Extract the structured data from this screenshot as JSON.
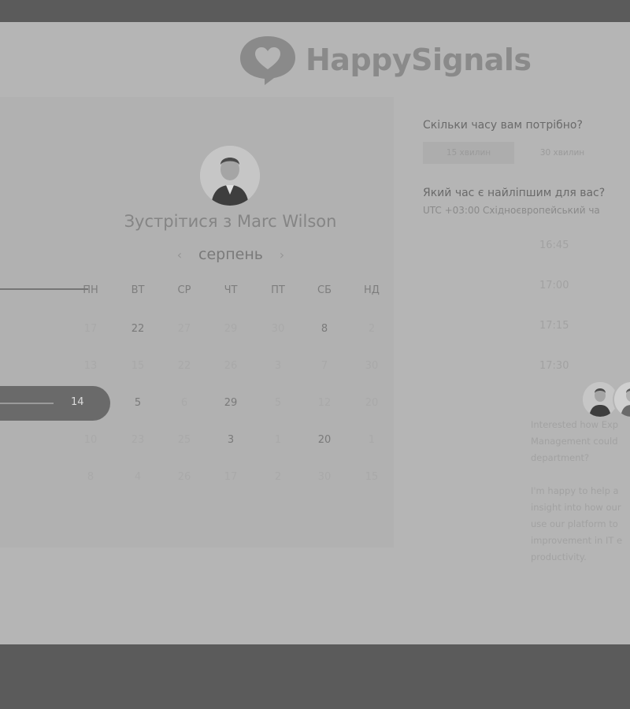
{
  "brand": {
    "name": "HappySignals"
  },
  "calendar": {
    "title": "Зустрітися з Marc Wilson",
    "month": "серпень",
    "prev_icon": "‹",
    "next_icon": "›",
    "weekdays": [
      "ПН",
      "ВТ",
      "СР",
      "ЧТ",
      "ПТ",
      "СБ",
      "НД"
    ],
    "selected_day": "14",
    "rows": [
      [
        "",
        "22",
        "",
        "",
        "",
        "8",
        ""
      ],
      [
        "",
        "",
        "",
        "",
        "",
        "",
        ""
      ],
      [
        "14",
        "5",
        "",
        "29",
        "",
        "",
        ""
      ],
      [
        "",
        "",
        "",
        "3",
        "",
        "20",
        ""
      ],
      [
        "",
        "",
        "",
        "",
        "",
        "",
        ""
      ]
    ],
    "dim_rows": [
      [
        "17",
        "",
        "27",
        "29",
        "30",
        "",
        "2"
      ],
      [
        "13",
        "15",
        "22",
        "26",
        "3",
        "7",
        "30"
      ],
      [
        "",
        "",
        "6",
        "",
        "5",
        "12",
        "20"
      ],
      [
        "10",
        "23",
        "25",
        "",
        "1",
        "",
        "1"
      ],
      [
        "8",
        "4",
        "26",
        "17",
        "2",
        "30",
        "15"
      ]
    ]
  },
  "scheduler": {
    "duration_question": "Скільки часу вам потрібно?",
    "durations": [
      "15 хвилин",
      "30 хвилин"
    ],
    "time_question": "Який час є найліпшим для вас?",
    "timezone": "UTC +03:00 Східноєвропейський ча",
    "slots": [
      "16:45",
      "17:00",
      "17:15",
      "17:30"
    ]
  },
  "description": {
    "lines": [
      "Interested how Exp",
      "Management could",
      "department?",
      "",
      "I'm happy to help a",
      "insight into how our",
      "use our platform to",
      "improvement in IT e",
      "productivity."
    ]
  },
  "colors": {
    "overlay_dark": "#5b5b5b",
    "page_bg": "#b5b5b5",
    "selected": "#6a6a6a"
  }
}
